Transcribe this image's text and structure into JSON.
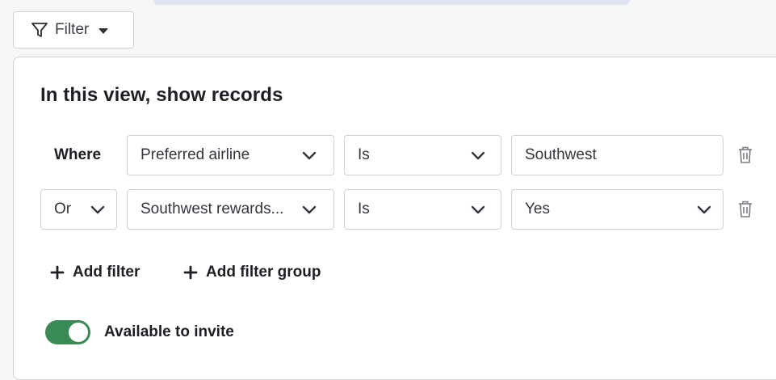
{
  "toolbar": {
    "filter_label": "Filter",
    "filter_icon": "funnel-icon"
  },
  "panel": {
    "title": "In this view, show records",
    "rows": [
      {
        "conjunction": "Where",
        "field": "Preferred airline",
        "operator": "Is",
        "value": "Southwest"
      },
      {
        "conjunction": "Or",
        "field": "Southwest rewards...",
        "operator": "Is",
        "value": "Yes"
      }
    ],
    "add_filter_label": "Add filter",
    "add_filter_group_label": "Add filter group",
    "toggle": {
      "label": "Available to invite",
      "on": true
    }
  },
  "colors": {
    "toggle_on": "#3a8a55",
    "border": "#cfd1d6",
    "text": "#1d1f25"
  }
}
